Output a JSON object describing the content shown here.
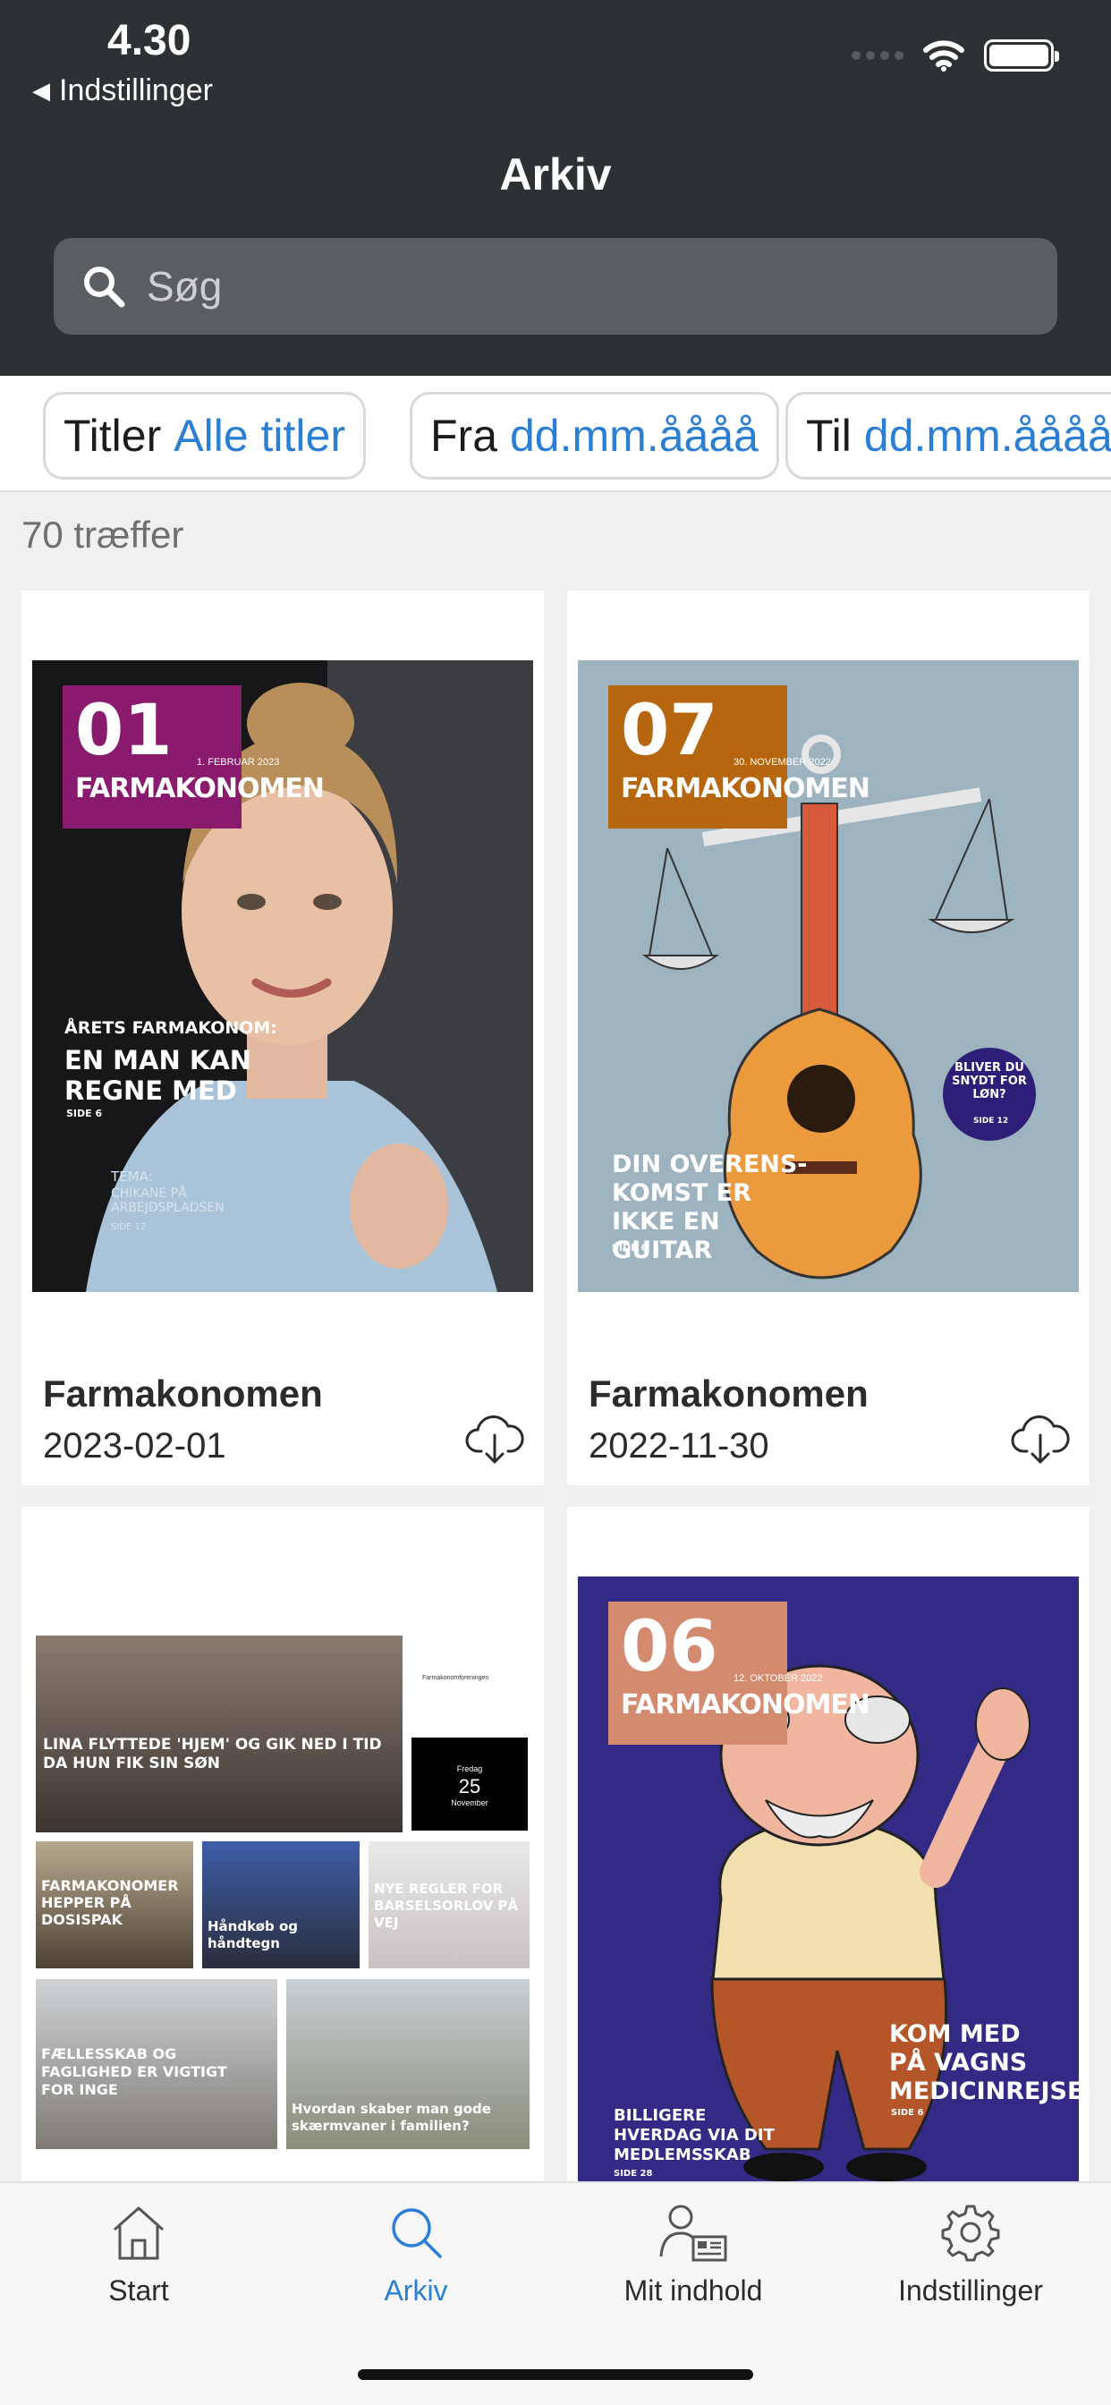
{
  "status_bar": {
    "time": "4.30",
    "back_label": "Indstillinger"
  },
  "header": {
    "title": "Arkiv"
  },
  "search": {
    "placeholder": "Søg"
  },
  "filters": [
    {
      "label": "Titler",
      "value": "Alle titler"
    },
    {
      "label": "Fra",
      "value": "dd.mm.åååå"
    },
    {
      "label": "Til",
      "value": "dd.mm.åååå"
    }
  ],
  "results": {
    "count_text": "70 træffer"
  },
  "issues": [
    {
      "title": "Farmakonomen",
      "date": "2023-02-01",
      "cover": {
        "number": "01",
        "name": "FARMAKONOMEN",
        "issue_date": "1. FEBRUAR 2023",
        "kicker": "ÅRETS FARMAKONOM:",
        "headline": "EN MAN KAN REGNE MED",
        "page": "SIDE 6",
        "theme": "TEMA:",
        "theme_sub": "CHIKANE PÅ ARBEJDSPLADSEN",
        "theme_page": "SIDE 12",
        "badge_color": "#8a1a6e"
      }
    },
    {
      "title": "Farmakonomen",
      "date": "2022-11-30",
      "cover": {
        "number": "07",
        "name": "FARMAKONOMEN",
        "issue_date": "30. NOVEMBER 2022",
        "headline": "DIN OVERENS-KOMST ER IKKE EN GUITAR",
        "page": "SIDE 6",
        "circle": "BLIVER DU SNYDT FOR LØN?",
        "circle_page": "SIDE 12",
        "badge_color": "#b5660f"
      }
    },
    {
      "cover": {
        "main_headline": "LINA FLYTTEDE 'HJEM' OG GIK NED I TID DA HUN FIK SIN SØN",
        "weekday": "Fredag",
        "day": "25",
        "month": "November",
        "logo_text": "Farmakonomforeningen",
        "tiles": [
          "FARMAKONOMER HEPPER PÅ DOSISPAK",
          "Håndkøb og håndtegn",
          "NYE REGLER FOR BARSELSORLOV PÅ VEJ",
          "FÆLLESSKAB OG FAGLIGHED ER VIGTIGT FOR INGE",
          "Hvordan skaber man gode skærmvaner i familien?"
        ]
      }
    },
    {
      "cover": {
        "number": "06",
        "name": "FARMAKONOMEN",
        "issue_date": "12. OKTOBER 2022",
        "headline": "KOM MED PÅ VAGNS MEDICINREJSE",
        "page": "SIDE 6",
        "subhead": "BILLIGERE HVERDAG VIA DIT MEDLEMSSKAB",
        "sub_page": "SIDE 28",
        "badge_color": "#d38a6e"
      }
    }
  ],
  "tabbar": [
    {
      "label": "Start",
      "icon": "home-icon",
      "active": false
    },
    {
      "label": "Arkiv",
      "icon": "search-icon",
      "active": true
    },
    {
      "label": "Mit indhold",
      "icon": "user-newspaper-icon",
      "active": false
    },
    {
      "label": "Indstillinger",
      "icon": "gear-icon",
      "active": false
    }
  ],
  "colors": {
    "header_bg": "#2e3134",
    "accent": "#2a7fd4",
    "page_bg": "#f0f0f0"
  }
}
